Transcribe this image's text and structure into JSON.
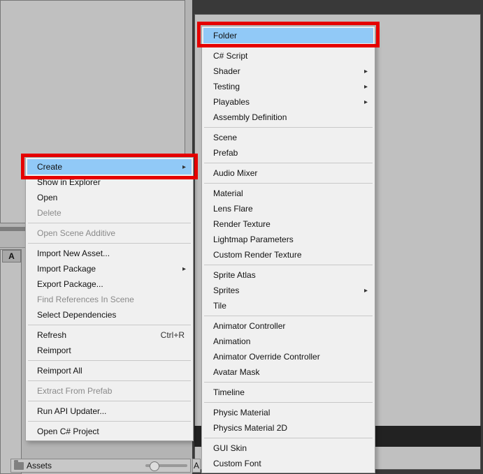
{
  "panels": {
    "bottom_tab": "A"
  },
  "footer": {
    "assets_label": "Assets",
    "right_label": "A"
  },
  "menu1": {
    "create": "Create",
    "show_in_explorer": "Show in Explorer",
    "open": "Open",
    "delete": "Delete",
    "open_scene_additive": "Open Scene Additive",
    "import_new_asset": "Import New Asset...",
    "import_package": "Import Package",
    "export_package": "Export Package...",
    "find_references": "Find References In Scene",
    "select_dependencies": "Select Dependencies",
    "refresh": "Refresh",
    "refresh_shortcut": "Ctrl+R",
    "reimport": "Reimport",
    "reimport_all": "Reimport All",
    "extract_from_prefab": "Extract From Prefab",
    "run_api_updater": "Run API Updater...",
    "open_csharp_project": "Open C# Project"
  },
  "menu2": {
    "folder": "Folder",
    "csharp_script": "C# Script",
    "shader": "Shader",
    "testing": "Testing",
    "playables": "Playables",
    "assembly_definition": "Assembly Definition",
    "scene": "Scene",
    "prefab": "Prefab",
    "audio_mixer": "Audio Mixer",
    "material": "Material",
    "lens_flare": "Lens Flare",
    "render_texture": "Render Texture",
    "lightmap_parameters": "Lightmap Parameters",
    "custom_render_texture": "Custom Render Texture",
    "sprite_atlas": "Sprite Atlas",
    "sprites": "Sprites",
    "tile": "Tile",
    "animator_controller": "Animator Controller",
    "animation": "Animation",
    "animator_override_controller": "Animator Override Controller",
    "avatar_mask": "Avatar Mask",
    "timeline": "Timeline",
    "physic_material": "Physic Material",
    "physics_material_2d": "Physics Material 2D",
    "gui_skin": "GUI Skin",
    "custom_font": "Custom Font"
  }
}
